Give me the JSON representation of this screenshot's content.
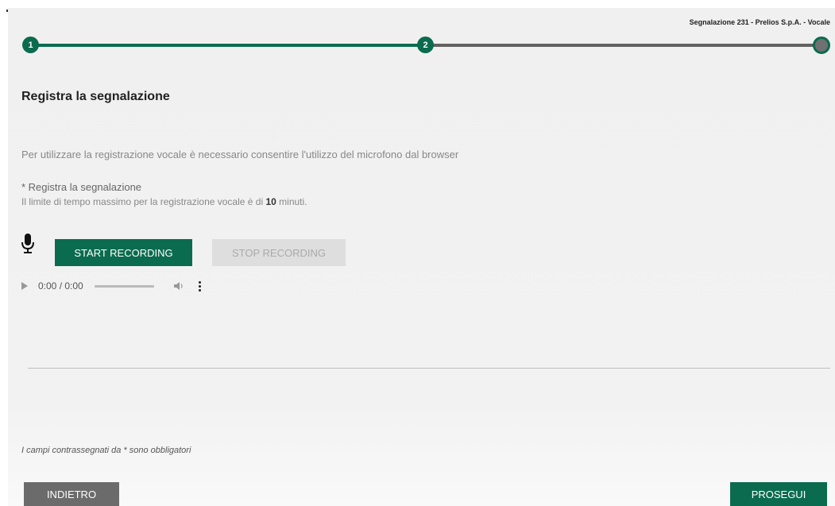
{
  "header": {
    "breadcrumb": "Segnalazione 231 - Prelios S.p.A. - Vocale"
  },
  "stepper": {
    "steps": [
      {
        "label": "1",
        "state": "done"
      },
      {
        "label": "2",
        "state": "done"
      },
      {
        "label": "",
        "state": "pending"
      }
    ],
    "active_color": "#0b6b4e",
    "inactive_color": "#616161"
  },
  "main": {
    "title": "Registra la segnalazione",
    "info_text": "Per utilizzare la registrazione vocale è necessario consentire l'utilizzo del microfono dal browser",
    "field_label": "* Registra la segnalazione",
    "limit_prefix": "Il limite di tempo massimo per la registrazione vocale è di ",
    "limit_value": "10",
    "limit_suffix": " minuti.",
    "mic_icon": "microphone-icon",
    "start_label": "START RECORDING",
    "stop_label": "STOP RECORDING",
    "audio": {
      "time": "0:00 / 0:00",
      "icons": [
        "play-icon",
        "volume-icon",
        "more-vertical-icon"
      ]
    }
  },
  "footer": {
    "required_note": "I campi contrassegnati da * sono obbligatori",
    "back_label": "INDIETRO",
    "next_label": "PROSEGUI"
  },
  "colors": {
    "primary": "#0b6b4e",
    "secondary_button": "#6b6b6b",
    "disabled_button": "#dedede"
  }
}
